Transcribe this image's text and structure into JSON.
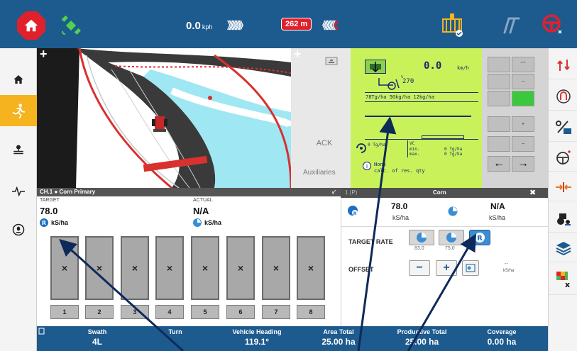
{
  "topbar": {
    "speed_value": "0.0",
    "speed_unit": "kph",
    "chevrons_left": "》》》》》",
    "distance_badge": "262 m",
    "chevrons_right": "《《《《",
    "chevrons_right_red": "《",
    "icons": [
      "home-icon",
      "satellite-icon",
      "implement-icon",
      "plow-icon",
      "steering-wheel-icon"
    ]
  },
  "leftbar": {
    "items": [
      "home-icon",
      "run-icon",
      "implement-icon",
      "pulse-icon",
      "seed-icon"
    ]
  },
  "map": {
    "zoom_in": "+",
    "zoom_in_right": "+"
  },
  "midpanel": {
    "ack_label": "ACK",
    "aux_label": "Auxiliaries"
  },
  "green_panel": {
    "speed": "0.0",
    "speed_unit": "km/h",
    "heading": "270",
    "heading_super": "%",
    "rates_line": "78Tg/ha 50kg/ha 12kg/ha",
    "tg_value": "0 Tg/ha",
    "vc_label": "VC",
    "min_label": "min.",
    "max_label": "max.",
    "min_value": "0 Tg/ha",
    "max_value": "0 Tg/ha",
    "none_label": "None",
    "calc_label": "calc. of res. qty"
  },
  "keypad": {
    "keys": [
      "",
      "",
      "",
      "",
      "",
      "",
      "←",
      "→"
    ]
  },
  "channel": {
    "header": "CH.1  ●  Corn Primary",
    "target_label": "TARGET",
    "target_value": "78.0",
    "target_unit": "kS/ha",
    "actual_label": "ACTUAL",
    "actual_value": "N/A",
    "actual_unit": "kS/ha"
  },
  "rows": {
    "marks": [
      "×",
      "×",
      "×",
      "×",
      "×",
      "×",
      "×",
      "×"
    ],
    "numbers": [
      "1",
      "2",
      "3",
      "4",
      "5",
      "6",
      "7",
      "8"
    ]
  },
  "rate_panel": {
    "header_left": "1   (P)",
    "header_title": "Corn",
    "close": "✖",
    "target_value": "78.0",
    "target_unit": "kS/ha",
    "actual_value": "N/A",
    "actual_unit": "kS/ha",
    "target_rate_label": "TARGET RATE",
    "preset1": "83.0",
    "preset2": "75.0",
    "offset_label": "OFFSET",
    "minus": "−",
    "plus": "+",
    "offset_value": "--",
    "offset_unit": "kS/ha"
  },
  "stats": [
    {
      "label": "Swath",
      "value": "4L"
    },
    {
      "label": "Turn",
      "value": ""
    },
    {
      "label": "Vehicle Heading",
      "value": "119.1°"
    },
    {
      "label": "Area Total",
      "value": "25.00 ha"
    },
    {
      "label": "Productive Total",
      "value": "25.00 ha"
    },
    {
      "label": "Coverage",
      "value": "0.00 ha"
    }
  ],
  "colors": {
    "brand_blue": "#1d5a8e",
    "alert_red": "#e0212c",
    "active_yellow": "#f5b320",
    "monitor_green": "#c9f25a"
  }
}
